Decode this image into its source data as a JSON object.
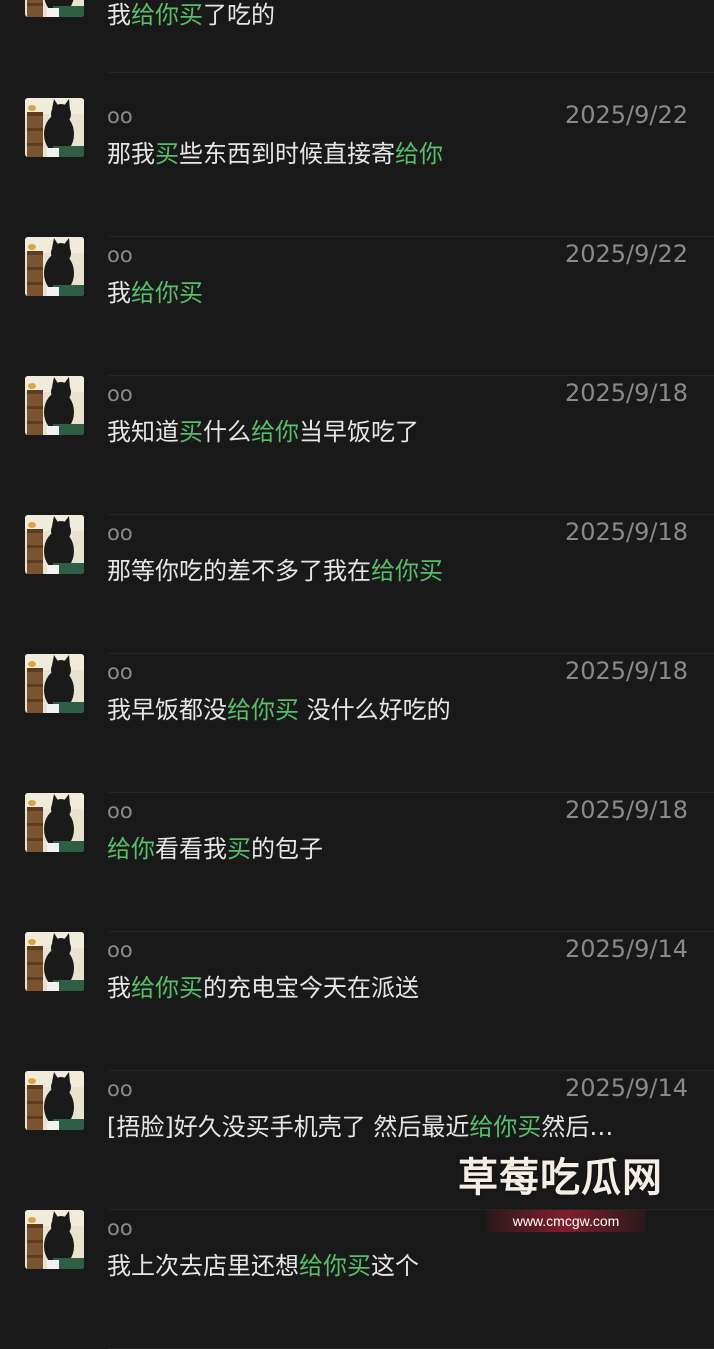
{
  "top_message": {
    "segments": [
      {
        "text": "我",
        "hl": false
      },
      {
        "text": "给你买",
        "hl": true
      },
      {
        "text": "了吃的",
        "hl": false
      }
    ]
  },
  "messages": [
    {
      "name": "oo",
      "date": "2025/9/22",
      "segments": [
        {
          "text": "那我",
          "hl": false
        },
        {
          "text": "买",
          "hl": true
        },
        {
          "text": "些东西到时候直接寄",
          "hl": false
        },
        {
          "text": "给你",
          "hl": true
        }
      ]
    },
    {
      "name": "oo",
      "date": "2025/9/22",
      "segments": [
        {
          "text": "我",
          "hl": false
        },
        {
          "text": "给你买",
          "hl": true
        }
      ]
    },
    {
      "name": "oo",
      "date": "2025/9/18",
      "segments": [
        {
          "text": "我知道",
          "hl": false
        },
        {
          "text": "买",
          "hl": true
        },
        {
          "text": "什么",
          "hl": false
        },
        {
          "text": "给你",
          "hl": true
        },
        {
          "text": "当早饭吃了",
          "hl": false
        }
      ]
    },
    {
      "name": "oo",
      "date": "2025/9/18",
      "segments": [
        {
          "text": "那等你吃的差不多了我在",
          "hl": false
        },
        {
          "text": "给你买",
          "hl": true
        }
      ]
    },
    {
      "name": "oo",
      "date": "2025/9/18",
      "segments": [
        {
          "text": "我早饭都没",
          "hl": false
        },
        {
          "text": "给你买",
          "hl": true
        },
        {
          "text": " 没什么好吃的",
          "hl": false
        }
      ]
    },
    {
      "name": "oo",
      "date": "2025/9/18",
      "segments": [
        {
          "text": "给你",
          "hl": true
        },
        {
          "text": "看看我",
          "hl": false
        },
        {
          "text": "买",
          "hl": true
        },
        {
          "text": "的包子",
          "hl": false
        }
      ]
    },
    {
      "name": "oo",
      "date": "2025/9/14",
      "segments": [
        {
          "text": "我",
          "hl": false
        },
        {
          "text": "给你买",
          "hl": true
        },
        {
          "text": "的充电宝今天在派送",
          "hl": false
        }
      ]
    },
    {
      "name": "oo",
      "date": "2025/9/14",
      "segments": [
        {
          "text": "[捂脸]好久没买手机壳了 然后最近",
          "hl": false
        },
        {
          "text": "给你买",
          "hl": true
        },
        {
          "text": "然后…",
          "hl": false
        }
      ]
    },
    {
      "name": "oo",
      "date": "",
      "segments": [
        {
          "text": "我上次去店里还想",
          "hl": false
        },
        {
          "text": "给你买",
          "hl": true
        },
        {
          "text": "这个",
          "hl": false
        }
      ]
    }
  ],
  "watermark": {
    "title": "草莓吃瓜网",
    "url": "www.cmcgw.com"
  },
  "colors": {
    "background": "#191919",
    "highlight": "#57be6a",
    "text": "#e6e6e6",
    "meta": "#8a8a8a"
  },
  "icons": {
    "avatar": "cat-avatar-icon"
  }
}
